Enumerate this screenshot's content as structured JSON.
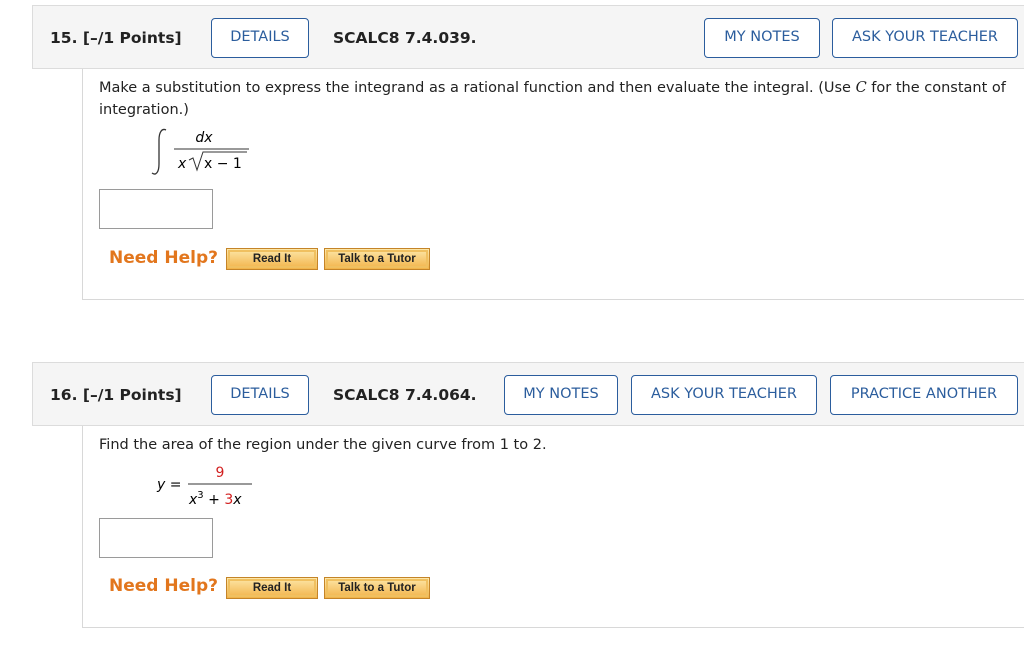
{
  "questions": [
    {
      "number": "15.",
      "points": "[–/1 Points]",
      "details_label": "DETAILS",
      "code": "SCALC8 7.4.039.",
      "my_notes_label": "MY NOTES",
      "ask_teacher_label": "ASK YOUR TEACHER",
      "prompt_part1": "Make a substitution to express the integrand as a rational function and then evaluate the integral. (Use ",
      "prompt_var": "C",
      "prompt_part2": " for the constant of integration.)",
      "integral": {
        "numerator": "dx",
        "denominator_x": "x",
        "radicand": "x − 1"
      },
      "answer_value": "",
      "need_help": "Need Help?",
      "read_it": "Read It",
      "talk_tutor": "Talk to a Tutor"
    },
    {
      "number": "16.",
      "points": "[–/1 Points]",
      "details_label": "DETAILS",
      "code": "SCALC8 7.4.064.",
      "my_notes_label": "MY NOTES",
      "ask_teacher_label": "ASK YOUR TEACHER",
      "practice_label": "PRACTICE ANOTHER",
      "prompt": "Find the area of the region under the given curve from 1 to 2.",
      "equation": {
        "lhs": "y =",
        "numerator": "9",
        "den_x": "x",
        "den_exp": "3",
        "den_plus": " + ",
        "den_coef": "3",
        "den_x2": "x"
      },
      "answer_value": "",
      "need_help": "Need Help?",
      "read_it": "Read It",
      "talk_tutor": "Talk to a Tutor"
    }
  ],
  "colors": {
    "accent": "#2b5d9d",
    "help": "#e2761d",
    "highlight": "#d21f1f"
  }
}
